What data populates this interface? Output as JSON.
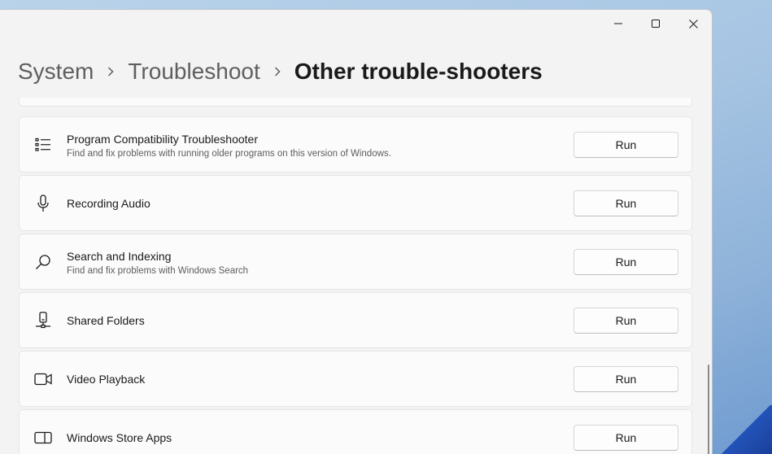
{
  "window": {
    "caption_buttons": [
      {
        "name": "minimize-button",
        "icon": "minimize-icon"
      },
      {
        "name": "maximize-button",
        "icon": "maximize-icon"
      },
      {
        "name": "close-button",
        "icon": "close-icon"
      }
    ]
  },
  "breadcrumb": {
    "items": [
      "System",
      "Troubleshoot",
      "Other trouble-shooters"
    ],
    "separator_icon": "chevron-right-icon"
  },
  "troubleshooters": [
    {
      "title": "Program Compatibility Troubleshooter",
      "description": "Find and fix problems with running older programs on this version of Windows.",
      "icon": "list-icon",
      "button": "Run"
    },
    {
      "title": "Recording Audio",
      "description": "",
      "icon": "microphone-icon",
      "button": "Run"
    },
    {
      "title": "Search and Indexing",
      "description": "Find and fix problems with Windows Search",
      "icon": "search-icon",
      "button": "Run"
    },
    {
      "title": "Shared Folders",
      "description": "",
      "icon": "network-drive-icon",
      "button": "Run"
    },
    {
      "title": "Video Playback",
      "description": "",
      "icon": "video-camera-icon",
      "button": "Run"
    },
    {
      "title": "Windows Store Apps",
      "description": "",
      "icon": "app-window-icon",
      "button": "Run"
    }
  ]
}
